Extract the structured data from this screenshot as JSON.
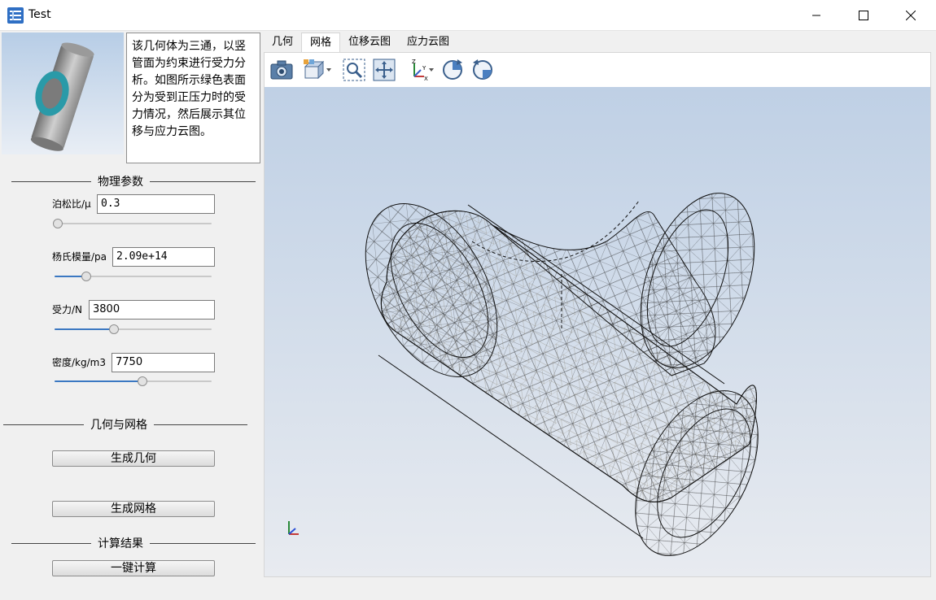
{
  "window": {
    "title": "Test",
    "icon": "app-icon",
    "controls": [
      "minimize-icon",
      "maximize-icon",
      "close-icon"
    ]
  },
  "description": "该几何体为三通，以竖管面为约束进行受力分析。如图所示绿色表面分为受到正压力时的受力情况，然后展示其位移与应力云图。",
  "physics": {
    "group_title": "物理参数",
    "params": [
      {
        "label": "泊松比/μ",
        "value": "0.3",
        "slider": 0.02
      },
      {
        "label": "杨氏模量/pa",
        "value": "2.09e+14",
        "slider": 0.2
      },
      {
        "label": "受力/N",
        "value": "3800",
        "slider": 0.38
      },
      {
        "label": "密度/kg/m3",
        "value": "7750",
        "slider": 0.56
      }
    ]
  },
  "geometry_mesh": {
    "group_title": "几何与网格",
    "gen_geometry": "生成几何",
    "gen_mesh": "生成网格"
  },
  "results": {
    "group_title": "计算结果",
    "compute": "一键计算"
  },
  "tabs": [
    {
      "label": "几何",
      "active": false
    },
    {
      "label": "网格",
      "active": true
    },
    {
      "label": "位移云图",
      "active": false
    },
    {
      "label": "应力云图",
      "active": false
    }
  ],
  "toolbar": [
    "camera-icon",
    "view-cube-icon",
    "zoom-box-icon",
    "fit-all-icon",
    "axes-icon",
    "rotate-cw-icon",
    "rotate-ccw-icon"
  ],
  "colors": {
    "viewport_top": "#bfd0e5",
    "viewport_bottom": "#e8ebf0",
    "slider_fill": "#3b78c2",
    "thumb_ring": "#2a9aa8"
  }
}
